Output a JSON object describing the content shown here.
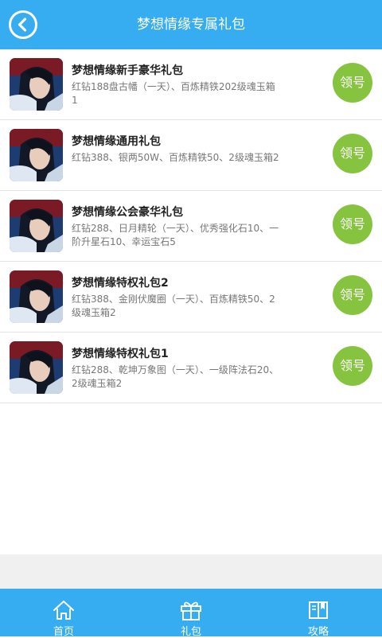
{
  "header": {
    "title": "梦想情缘专属礼包",
    "back_icon": "back-arrow-icon"
  },
  "colors": {
    "primary": "#35adf0",
    "claim_button": "#86c440"
  },
  "gifts": [
    {
      "name": "梦想情缘新手豪华礼包",
      "desc": "红钻188盘古幡（一天）、百炼精铁202级魂玉箱1",
      "button": "领号"
    },
    {
      "name": "梦想情缘通用礼包",
      "desc": "红钻388、银两50W、百炼精铁50、2级魂玉箱2",
      "button": "领号"
    },
    {
      "name": "梦想情缘公会豪华礼包",
      "desc": "红钻288、日月精轮（一天）、优秀强化石10、一阶升星石10、幸运宝石5",
      "button": "领号"
    },
    {
      "name": "梦想情缘特权礼包2",
      "desc": "红钻388、金刚伏魔圈（一天）、百炼精铁50、2级魂玉箱2",
      "button": "领号"
    },
    {
      "name": "梦想情缘特权礼包1",
      "desc": "红钻288、乾坤万象图（一天）、一级阵法石20、2级魂玉箱2",
      "button": "领号"
    }
  ],
  "tabbar": {
    "items": [
      {
        "label": "首页",
        "icon": "home-icon"
      },
      {
        "label": "礼包",
        "icon": "gift-icon"
      },
      {
        "label": "攻略",
        "icon": "book-icon"
      }
    ]
  }
}
